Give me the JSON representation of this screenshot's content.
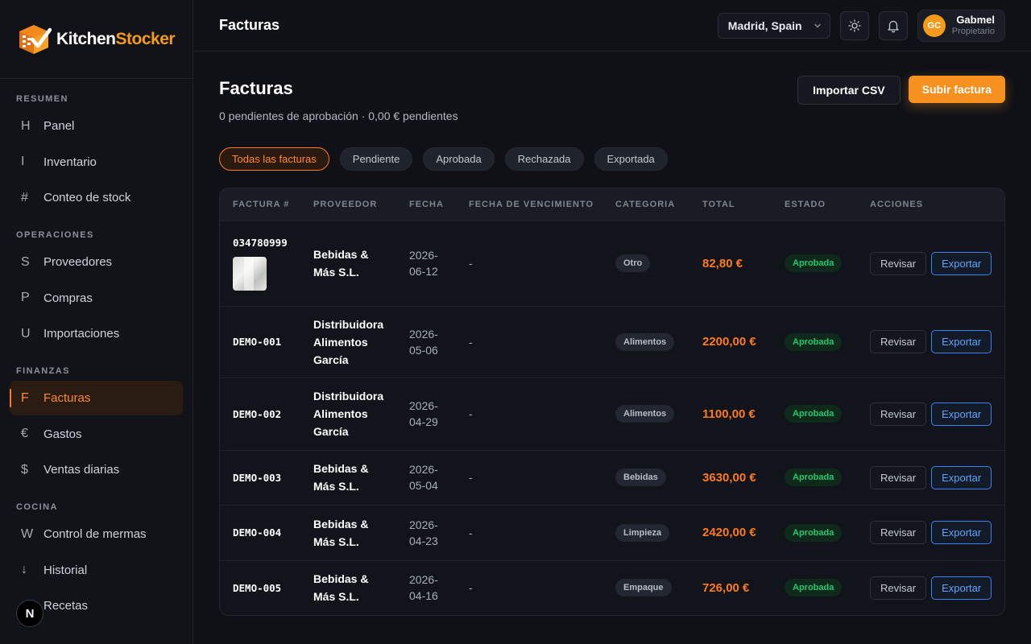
{
  "brand": {
    "name_a": "Kitchen",
    "name_b": "Stocker"
  },
  "sidebar": {
    "sections": [
      {
        "heading": "RESUMEN",
        "items": [
          {
            "glyph": "H",
            "label": "Panel"
          },
          {
            "glyph": "I",
            "label": "Inventario"
          },
          {
            "glyph": "#",
            "label": "Conteo de stock"
          }
        ]
      },
      {
        "heading": "OPERACIONES",
        "items": [
          {
            "glyph": "S",
            "label": "Proveedores"
          },
          {
            "glyph": "P",
            "label": "Compras"
          },
          {
            "glyph": "U",
            "label": "Importaciones"
          }
        ]
      },
      {
        "heading": "FINANZAS",
        "items": [
          {
            "glyph": "F",
            "label": "Facturas",
            "active": true
          },
          {
            "glyph": "€",
            "label": "Gastos"
          },
          {
            "glyph": "$",
            "label": "Ventas diarias"
          }
        ]
      },
      {
        "heading": "COCINA",
        "items": [
          {
            "glyph": "W",
            "label": "Control de mermas"
          },
          {
            "glyph": "↓",
            "label": "Historial"
          },
          {
            "glyph": "",
            "label": "Recetas"
          }
        ]
      }
    ],
    "badge": "N"
  },
  "topbar": {
    "title": "Facturas",
    "location": "Madrid, Spain",
    "user": {
      "initials": "GC",
      "name": "Gabmel",
      "role": "Propietario"
    }
  },
  "page": {
    "title": "Facturas",
    "subtitle": "0 pendientes de aprobación · 0,00 € pendientes",
    "import_label": "Importar CSV",
    "upload_label": "Subir factura"
  },
  "filters": [
    {
      "label": "Todas las facturas",
      "active": true
    },
    {
      "label": "Pendiente"
    },
    {
      "label": "Aprobada"
    },
    {
      "label": "Rechazada"
    },
    {
      "label": "Exportada"
    }
  ],
  "table": {
    "headers": [
      "FACTURA #",
      "PROVEEDOR",
      "FECHA",
      "FECHA DE VENCIMIENTO",
      "CATEGORIA",
      "TOTAL",
      "ESTADO",
      "ACCIONES"
    ],
    "rows": [
      {
        "invoice": "034780999",
        "has_thumb": true,
        "supplier_lines": [
          "Bebidas &",
          "Más S.L."
        ],
        "date_lines": [
          "2026-",
          "06-12"
        ],
        "due": "-",
        "category": "Otro",
        "total": "82,80 €",
        "status": "Aprobada",
        "review": "Revisar",
        "export": "Exportar"
      },
      {
        "invoice": "DEMO-001",
        "supplier_lines": [
          "Distribuidora",
          "Alimentos",
          "García"
        ],
        "date_lines": [
          "2026-",
          "05-06"
        ],
        "due": "-",
        "category": "Alimentos",
        "total": "2200,00 €",
        "status": "Aprobada",
        "review": "Revisar",
        "export": "Exportar"
      },
      {
        "invoice": "DEMO-002",
        "supplier_lines": [
          "Distribuidora",
          "Alimentos",
          "García"
        ],
        "date_lines": [
          "2026-",
          "04-29"
        ],
        "due": "-",
        "category": "Alimentos",
        "total": "1100,00 €",
        "status": "Aprobada",
        "review": "Revisar",
        "export": "Exportar"
      },
      {
        "invoice": "DEMO-003",
        "supplier_lines": [
          "Bebidas &",
          "Más S.L."
        ],
        "date_lines": [
          "2026-",
          "05-04"
        ],
        "due": "-",
        "category": "Bebidas",
        "total": "3630,00 €",
        "status": "Aprobada",
        "review": "Revisar",
        "export": "Exportar"
      },
      {
        "invoice": "DEMO-004",
        "supplier_lines": [
          "Bebidas &",
          "Más S.L."
        ],
        "date_lines": [
          "2026-",
          "04-23"
        ],
        "due": "-",
        "category": "Limpieza",
        "total": "2420,00 €",
        "status": "Aprobada",
        "review": "Revisar",
        "export": "Exportar"
      },
      {
        "invoice": "DEMO-005",
        "supplier_lines": [
          "Bebidas &",
          "Más S.L."
        ],
        "date_lines": [
          "2026-",
          "04-16"
        ],
        "due": "-",
        "category": "Empaque",
        "total": "726,00 €",
        "status": "Aprobada",
        "review": "Revisar",
        "export": "Exportar"
      }
    ]
  },
  "colors": {
    "accent": "#f6901f",
    "success": "#28c76f",
    "link": "#60a5fa"
  }
}
